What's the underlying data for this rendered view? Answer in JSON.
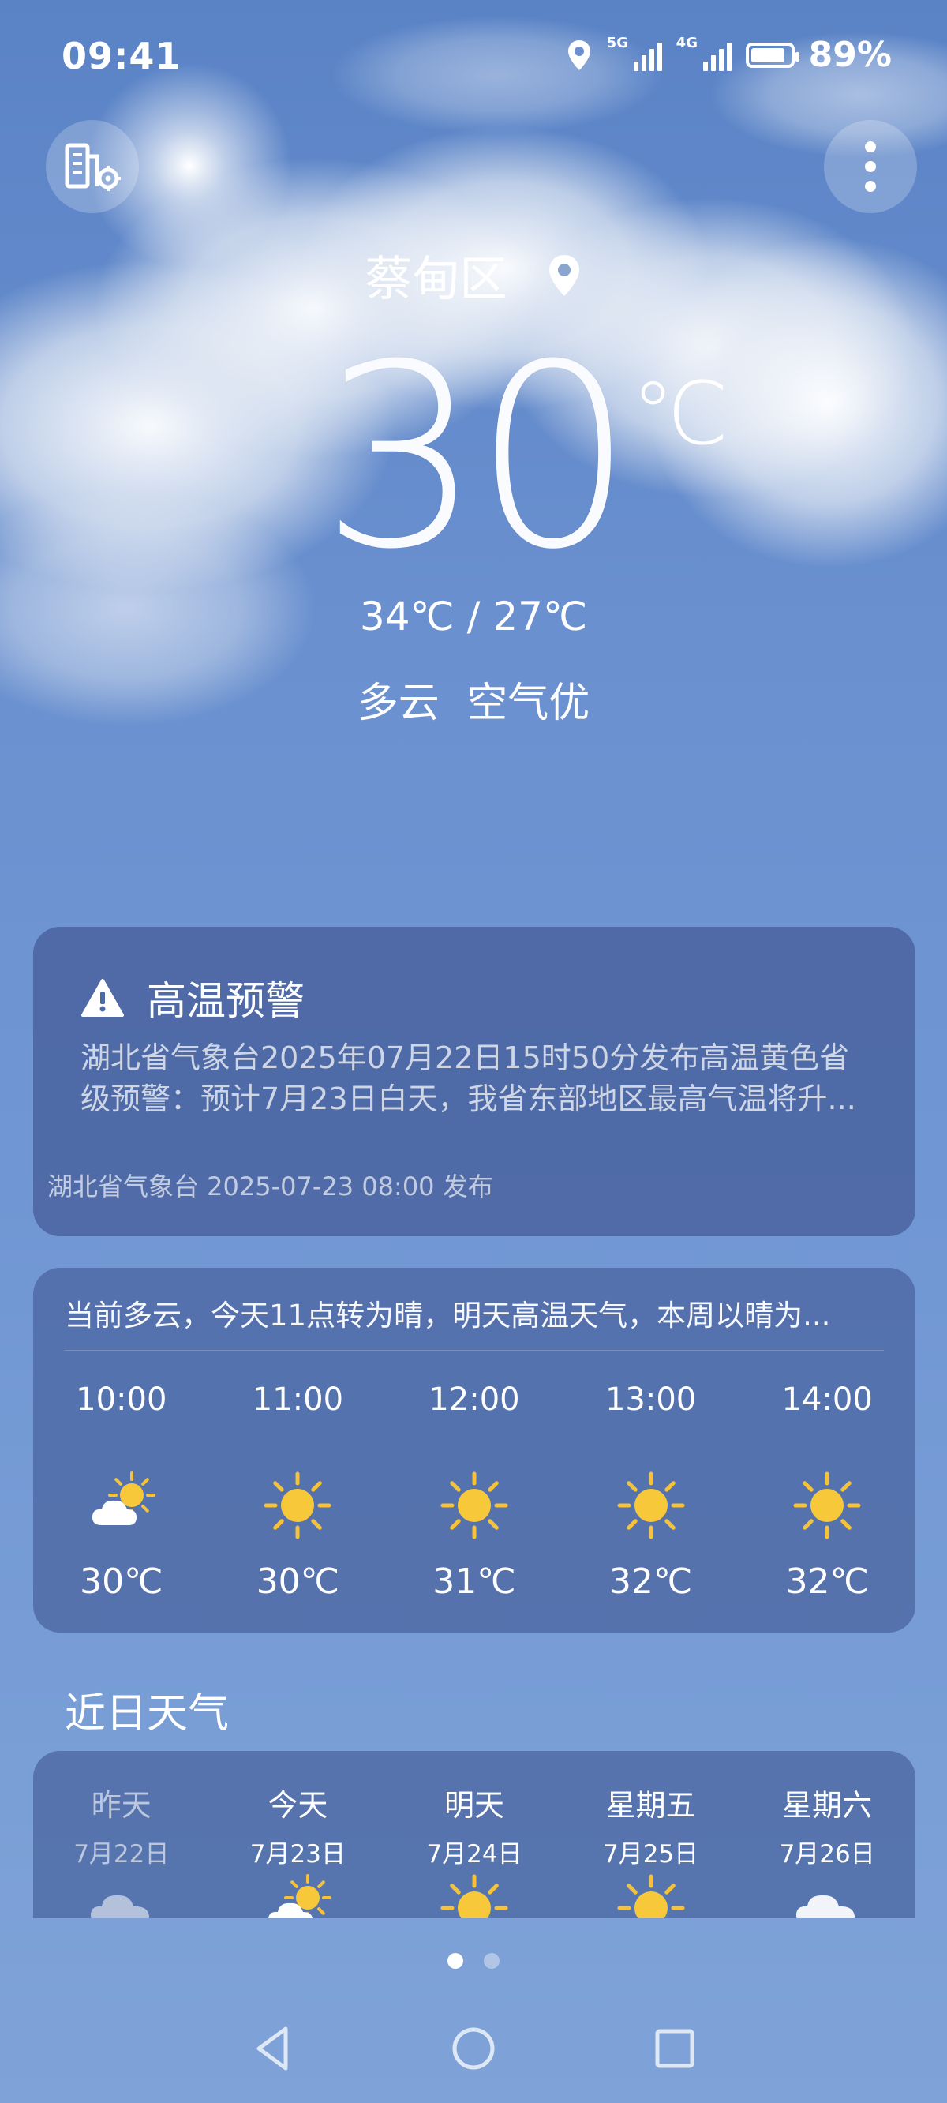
{
  "status_bar": {
    "time": "09:41",
    "signal_5g_label": "5G",
    "signal_4g_label": "4G",
    "battery_percent": "89%",
    "battery_level": 0.89
  },
  "header": {
    "city_manage_icon": "city-manage-icon",
    "more_icon": "more-vertical-icon",
    "location": "蔡甸区",
    "location_icon": "location-pin-icon"
  },
  "current": {
    "temperature": "30",
    "unit": "℃",
    "range": "34℃ / 27℃",
    "condition": "多云",
    "air_quality": "空气优"
  },
  "alert": {
    "title": "高温预警",
    "icon": "warning-triangle-icon",
    "body_line1": "湖北省气象台2025年07月22日15时50分发布高温黄色省",
    "body_line2": "级预警：预计7月23日白天，我省东部地区最高气温将升...",
    "footer": "湖北省气象台 2025-07-23 08:00 发布"
  },
  "hourly": {
    "summary": "当前多云，今天11点转为晴，明天高温天气，本周以晴为...",
    "items": [
      {
        "time": "10:00",
        "icon": "partly-cloudy-icon",
        "temp": "30℃"
      },
      {
        "time": "11:00",
        "icon": "sunny-icon",
        "temp": "30℃"
      },
      {
        "time": "12:00",
        "icon": "sunny-icon",
        "temp": "31℃"
      },
      {
        "time": "13:00",
        "icon": "sunny-icon",
        "temp": "32℃"
      },
      {
        "time": "14:00",
        "icon": "sunny-icon",
        "temp": "32℃"
      }
    ]
  },
  "recent": {
    "title": "近日天气",
    "days": [
      {
        "name": "昨天",
        "date": "7月22日",
        "icon": "cloudy-icon"
      },
      {
        "name": "今天",
        "date": "7月23日",
        "icon": "partly-cloudy-icon"
      },
      {
        "name": "明天",
        "date": "7月24日",
        "icon": "sunny-icon"
      },
      {
        "name": "星期五",
        "date": "7月25日",
        "icon": "sunny-icon"
      },
      {
        "name": "星期六",
        "date": "7月26日",
        "icon": "cloudy-icon"
      }
    ]
  },
  "pager": {
    "count": 2,
    "active": 0
  },
  "nav": {
    "back_icon": "back-triangle-icon",
    "home_icon": "home-circle-icon",
    "recents_icon": "recents-square-icon"
  },
  "colors": {
    "sun": "#f7c93a",
    "sun_ray": "#f5c23a",
    "cloud": "#ffffff"
  }
}
